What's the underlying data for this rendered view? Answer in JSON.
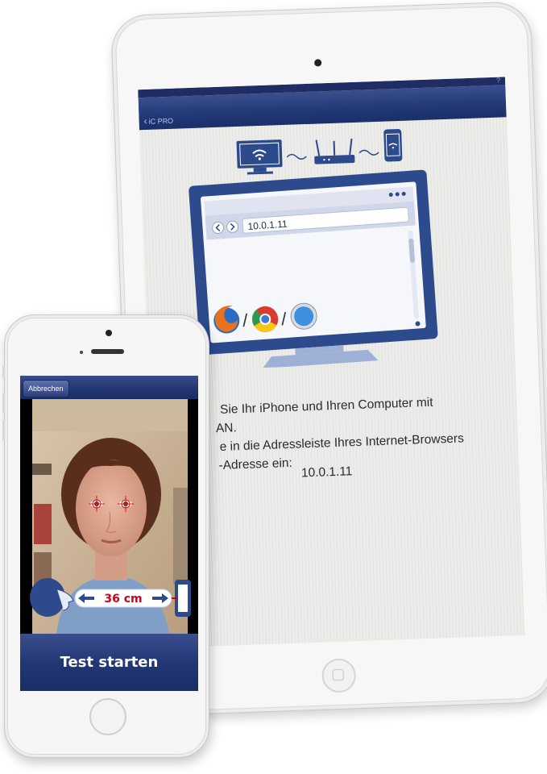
{
  "ipad": {
    "back_label": "iC PRO",
    "help_label": "?",
    "browser_url": "10.0.1.11",
    "instructions": [
      "Sie Ihr iPhone und Ihren Computer mit",
      "AN.",
      "e in die Adressleiste Ihres Internet-Browsers",
      "-Adresse ein:"
    ],
    "ip_address": "10.0.1.11"
  },
  "iphone": {
    "cancel_label": "Abbrechen",
    "distance_label": "36 cm",
    "start_button_label": "Test starten"
  },
  "colors": {
    "navy": "#1f2d62",
    "monitor_blue": "#2c4a8c",
    "distance_red": "#d0021b"
  },
  "icons": [
    "wifi-icon",
    "router-icon",
    "phone-icon",
    "firefox-icon",
    "chrome-icon",
    "safari-icon",
    "head-icon"
  ]
}
